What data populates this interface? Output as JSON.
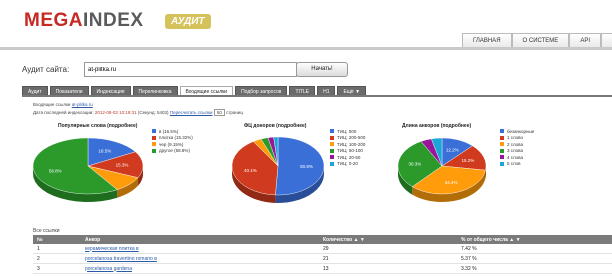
{
  "brand": {
    "name_part1": "MEGA",
    "name_part2": "INDEX",
    "badge": "АУДИТ"
  },
  "top_nav": [
    "ГЛАВНАЯ",
    "О СИСТЕМЕ",
    "API",
    "КОНТ"
  ],
  "audit": {
    "label": "Аудит сайта:",
    "value": "at-plitka.ru",
    "button": "Начать!"
  },
  "tabs": [
    {
      "label": "Аудит",
      "active": false
    },
    {
      "label": "Показатели",
      "active": false
    },
    {
      "label": "Индексация",
      "active": false
    },
    {
      "label": "Перелинковка",
      "active": false
    },
    {
      "label": "Входящие ссылки",
      "active": true
    },
    {
      "label": "Подбор запросов",
      "active": false
    },
    {
      "label": "TITLE",
      "active": false
    },
    {
      "label": "H1",
      "active": false
    },
    {
      "label": "Ещё ▼",
      "active": false
    }
  ],
  "meta": {
    "incoming_prefix": "Входящие ссылки",
    "incoming_site": "at-plitka.ru",
    "date_label": "Дата последней индексации:",
    "date_value": "2012-08-03 10:19:31",
    "date_suffix": "(Секунд: 5403)",
    "recalc_link": "Пересчитать ссылки",
    "pages_value": "50",
    "pages_suffix": "страниц"
  },
  "colors": {
    "blue": "#3a6fd8",
    "red": "#d03a1e",
    "orange": "#ff9c0c",
    "green": "#2b9a2b",
    "purple": "#99169a",
    "cyan": "#1aa6d6"
  },
  "chart_data": [
    {
      "type": "pie",
      "title": "Популярные слова (подробнее)",
      "categories": [
        "в",
        "плитка",
        "чер",
        "другое"
      ],
      "legend": [
        "в (16.5%)",
        "плитка (15.32%)",
        "чер (9.15%)",
        "другое (58.8%)"
      ],
      "values": [
        16.5,
        15.3,
        9.2,
        58.8
      ],
      "data_labels": [
        "16.5%",
        "15.3%",
        "",
        "58.8%"
      ]
    },
    {
      "type": "pie",
      "title": "ФЦ доноров (подробнее)",
      "categories": [
        "ТИЦ: 500",
        "ТИЦ: 200-500",
        "ТИЦ: 100-200",
        "ТИЦ: 50-100",
        "ТИЦ: 20-50",
        "ТИЦ: 0-20"
      ],
      "legend": [
        "ТИЦ: 500",
        "ТИЦ: 200-500",
        "ТИЦ: 100-200",
        "ТИЦ: 50-100",
        "ТИЦ: 20-50",
        "ТИЦ: 0-20"
      ],
      "values": [
        50.9,
        40.1,
        3.0,
        2.5,
        2.0,
        1.5
      ],
      "data_labels": [
        "50.9%",
        "40.1%",
        "",
        "",
        "",
        ""
      ]
    },
    {
      "type": "pie",
      "title": "Длина анкоров (подробнее)",
      "categories": [
        "безанкорные",
        "1 слово",
        "2 слова",
        "3 слова",
        "4 слова",
        "5 слов"
      ],
      "legend": [
        "безанкорные",
        "1 слово",
        "2 слова",
        "3 слова",
        "4 слова",
        "5 слов"
      ],
      "values": [
        12.2,
        15.2,
        34.4,
        30.3,
        4.0,
        3.9
      ],
      "data_labels": [
        "12.2%",
        "15.2%",
        "34.4%",
        "30.3%",
        "",
        ""
      ]
    }
  ],
  "links_table": {
    "title": "Все ссылки",
    "headers": [
      "№",
      "Анкор",
      "Количество ▲ ▼",
      "% от общего числа ▲ ▼"
    ],
    "rows": [
      [
        "1",
        "керамическая плитка в",
        "29",
        "7.42 %"
      ],
      [
        "2",
        "porcelanosa travertino romano в",
        "21",
        "5.37 %"
      ],
      [
        "3",
        "porcelanosa gardena",
        "13",
        "3.32 %"
      ]
    ]
  }
}
